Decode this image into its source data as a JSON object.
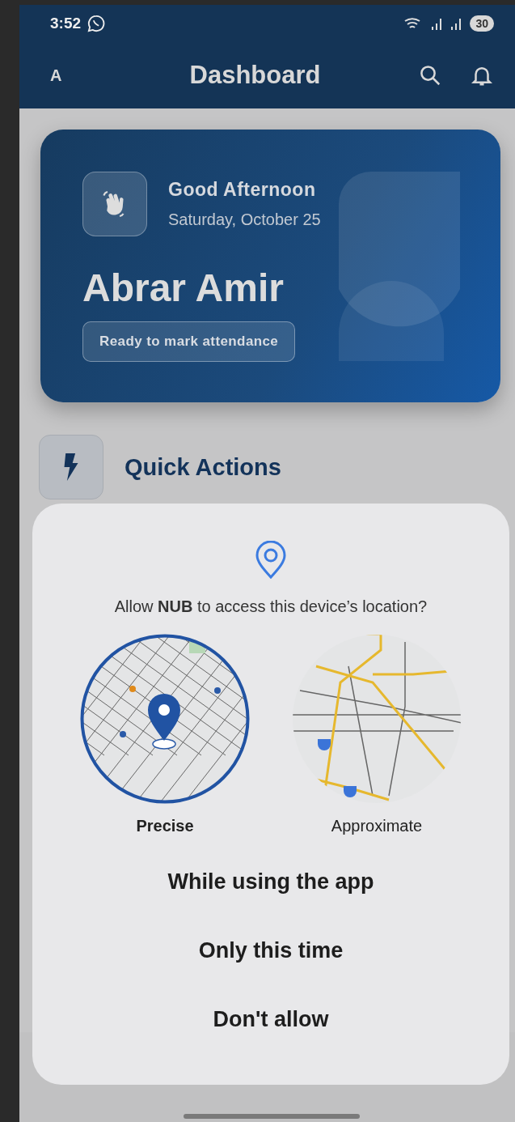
{
  "status_bar": {
    "time": "3:52",
    "battery": "30"
  },
  "app_bar": {
    "avatar": "A",
    "title": "Dashboard"
  },
  "welcome_card": {
    "greeting": "Good Afternoon",
    "date": "Saturday, October 25",
    "name": "Abrar Amir",
    "status": "Ready to mark attendance"
  },
  "quick_actions": {
    "title": "Quick Actions"
  },
  "dialog": {
    "question": "Allow **NUB** to access this device’s location?",
    "precision": [
      {
        "kind": "precise",
        "label": "Precise",
        "selected": true
      },
      {
        "kind": "approximate",
        "label": "Approximate",
        "selected": false
      }
    ],
    "options": [
      "While using the app",
      "Only this time",
      "Don't allow"
    ]
  }
}
